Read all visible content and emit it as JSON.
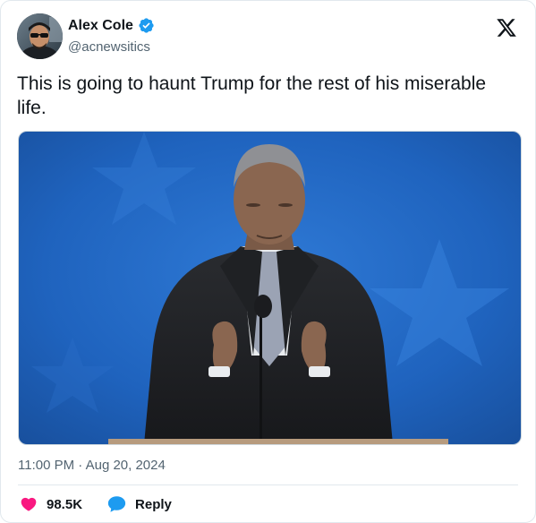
{
  "author": {
    "display_name": "Alex Cole",
    "handle": "@acnewsitics",
    "verified": true
  },
  "tweet": {
    "text": "This is going to haunt Trump for the rest of his miserable life.",
    "timestamp": "11:00 PM · Aug 20, 2024"
  },
  "actions": {
    "like_count": "98.5K",
    "reply_label": "Reply"
  },
  "icons": {
    "brand": "x-logo-icon",
    "verified": "verified-badge-icon",
    "like": "heart-icon",
    "reply": "speech-bubble-icon"
  },
  "colors": {
    "verified_blue": "#1d9bf0",
    "like_red": "#f91880",
    "reply_blue": "#1d9bf0",
    "muted_text": "#536471",
    "primary_text": "#0f1419",
    "media_background": "#1d5fb2"
  }
}
